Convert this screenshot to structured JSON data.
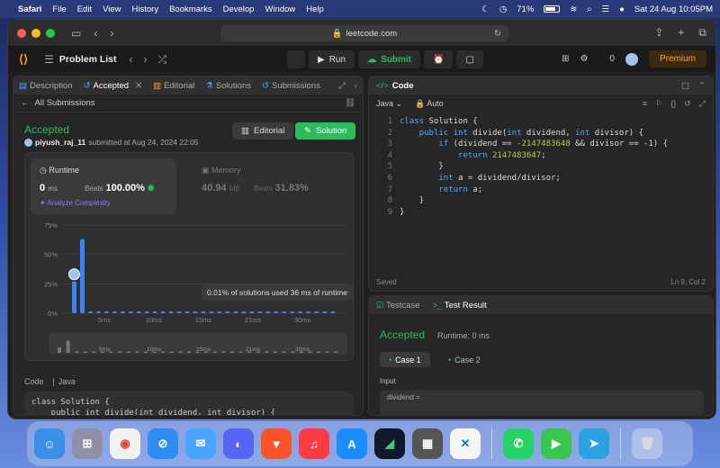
{
  "menubar": {
    "app_name": "Safari",
    "items": [
      "File",
      "Edit",
      "View",
      "History",
      "Bookmarks",
      "Develop",
      "Window",
      "Help"
    ],
    "battery": "71%",
    "datetime": "Sat 24 Aug  10:05PM"
  },
  "safari": {
    "url": "leetcode.com"
  },
  "lc_nav": {
    "problem_list": "Problem List",
    "run": "Run",
    "submit": "Submit",
    "streak": "0",
    "premium": "Premium"
  },
  "left": {
    "tabs": [
      "Description",
      "Accepted",
      "Editorial",
      "Solutions",
      "Submissions"
    ],
    "all_submissions": "All Submissions",
    "status": "Accepted",
    "username": "piyush_raj_11",
    "submitted_at": "submitted at Aug 24, 2024 22:05",
    "editorial_btn": "Editorial",
    "solution_btn": "Solution",
    "runtime": {
      "label": "Runtime",
      "value": "0",
      "unit": "ms",
      "beats_label": "Beats",
      "beats_value": "100.00%",
      "analyze": "Analyze Complexity"
    },
    "memory": {
      "label": "Memory",
      "value": "40.94",
      "unit": "MB",
      "beats_label": "Beats",
      "beats_value": "31.83%"
    },
    "tooltip": "0.01% of solutions used 36 ms of runtime",
    "code_label": "Code",
    "code_lang": "Java",
    "code_preview": [
      "class Solution {",
      "    public int divide(int dividend, int divisor) {"
    ]
  },
  "chart_data": {
    "type": "bar",
    "ylabel": "",
    "xlabel": "",
    "y_ticks": [
      "75%",
      "50%",
      "25%",
      "0%"
    ],
    "x_ticks": [
      "5ms",
      "10ms",
      "15ms",
      "21ms",
      "30ms"
    ],
    "ylim": [
      0,
      75
    ],
    "values": [
      27,
      63,
      1,
      1,
      1,
      1,
      1,
      1,
      1,
      1,
      1,
      1,
      1,
      1,
      1,
      1,
      1,
      1,
      1,
      1,
      1,
      1,
      1,
      1,
      1,
      1,
      1,
      1,
      1,
      1,
      1,
      1,
      1
    ],
    "highlight_index": 0,
    "bar_color": "#3b82f6"
  },
  "code": {
    "tab": "Code",
    "lang": "Java",
    "mode": "Auto",
    "lines": [
      "class Solution {",
      "    public int divide(int dividend, int divisor) {",
      "        if (dividend == -2147483648 && divisor == -1) {",
      "            return 2147483647;",
      "        }",
      "        int a = dividend/divisor;",
      "        return a;",
      "    }",
      "}"
    ],
    "line_numbers": [
      "1",
      "2",
      "3",
      "4",
      "5",
      "6",
      "7",
      "8",
      "9"
    ],
    "saved": "Saved",
    "cursor": "Ln 9, Col 2"
  },
  "result": {
    "tab_testcase": "Testcase",
    "tab_result": "Test Result",
    "status": "Accepted",
    "runtime": "Runtime: 0 ms",
    "case1": "Case 1",
    "case2": "Case 2",
    "input_label": "Input",
    "input_name": "dividend ="
  },
  "dock": [
    "Finder",
    "Launchpad",
    "Chrome",
    "Safari",
    "Mail",
    "Discord",
    "Brave",
    "Music",
    "App Store",
    "Terminal",
    "Calculator",
    "VS Code",
    "WhatsApp",
    "FaceTime",
    "Telegram",
    "Trash"
  ]
}
